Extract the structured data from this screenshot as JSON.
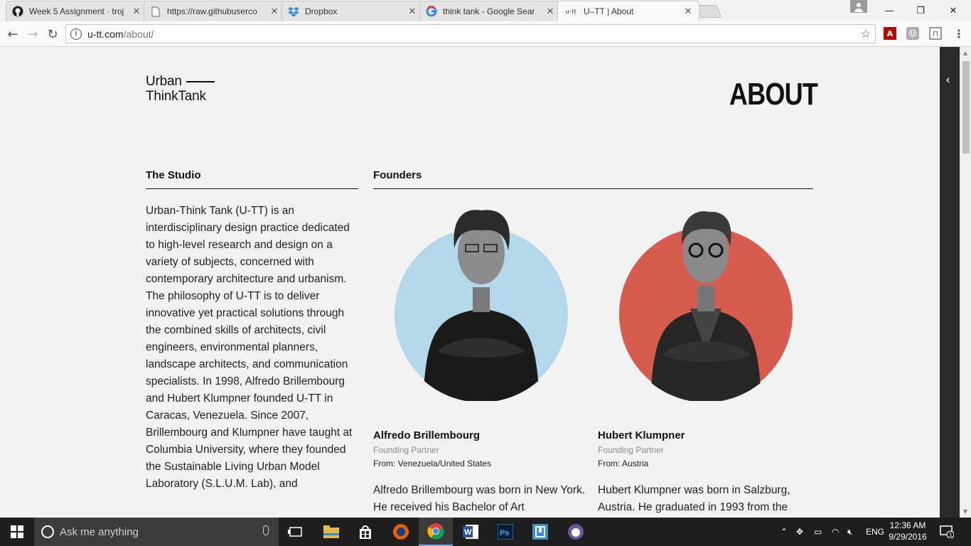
{
  "browser": {
    "tabs": [
      {
        "title": "Week 5 Assignment · troj",
        "icon": "github-icon"
      },
      {
        "title": "https://raw.githubuserco",
        "icon": "page-icon"
      },
      {
        "title": "Dropbox",
        "icon": "dropbox-icon"
      },
      {
        "title": "think tank - Google Sear",
        "icon": "google-icon"
      },
      {
        "title": "U–TT | About",
        "icon": "utt-icon",
        "favicon_text": "u–tt",
        "active": true
      }
    ],
    "url_host": "u-tt.com",
    "url_path": "/about/",
    "extensions": [
      {
        "name": "acrobat-icon",
        "label": "A"
      },
      {
        "name": "extension-icon",
        "label": "Ⓤ"
      },
      {
        "name": "readability-icon",
        "label": "⊓"
      }
    ]
  },
  "page": {
    "logo_line1": "Urban",
    "logo_line2": "ThinkTank",
    "heading": "ABOUT",
    "studio": {
      "title": "The Studio",
      "body": "Urban-Think Tank (U-TT) is an interdisciplinary design practice dedicated to high-level research and design on a variety of subjects, concerned with contemporary architecture and urbanism. The philosophy of U-TT is to deliver innovative yet practical solutions through the combined skills of architects, civil engineers, environmental planners, landscape architects, and communication specialists. In 1998, Alfredo Brillembourg and Hubert Klumpner founded U-TT in Caracas, Venezuela. Since 2007, Brillembourg and Klumpner have taught at Columbia University, where they founded the Sustainable Living Urban Model Laboratory (S.L.U.M. Lab), and"
    },
    "founders_title": "Founders",
    "founders": [
      {
        "name": "Alfredo Brillembourg",
        "role": "Founding Partner",
        "from": "From: Venezuela/United States",
        "bio": "Alfredo Brillembourg was born in New York. He received his Bachelor of Art",
        "circle_color": "#b5d7ea"
      },
      {
        "name": "Hubert Klumpner",
        "role": "Founding Partner",
        "from": "From: Austria",
        "bio": "Hubert Klumpner was born in Salzburg, Austria. He graduated in 1993 from the",
        "circle_color": "#d55c4f"
      }
    ]
  },
  "taskbar": {
    "search_placeholder": "Ask me anything",
    "apps": [
      "task-view-icon",
      "file-explorer-icon",
      "store-icon",
      "firefox-icon",
      "chrome-icon",
      "word-icon",
      "photoshop-icon",
      "app-icon",
      "github-desktop-icon"
    ],
    "language": "ENG",
    "time": "12:36 AM",
    "date": "9/29/2016",
    "notification_count": "1"
  }
}
